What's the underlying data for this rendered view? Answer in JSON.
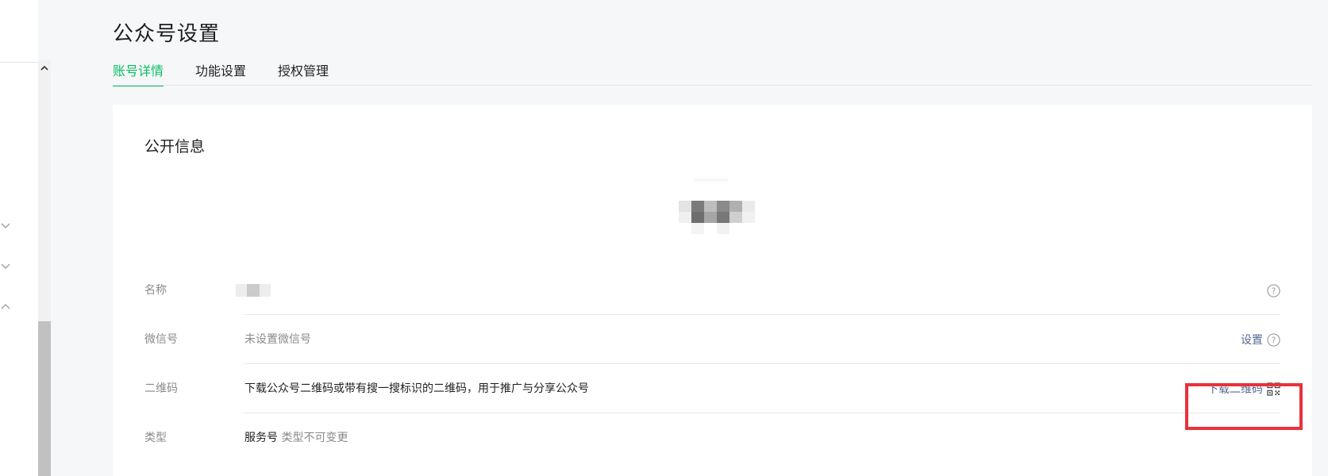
{
  "header": {
    "title": "公众号设置",
    "tabs": [
      {
        "label": "账号详情",
        "active": true
      },
      {
        "label": "功能设置",
        "active": false
      },
      {
        "label": "授权管理",
        "active": false
      }
    ]
  },
  "card": {
    "section_title": "公开信息",
    "rows": {
      "name": {
        "label": "名称"
      },
      "wechat_id": {
        "label": "微信号",
        "value": "未设置微信号",
        "action": "设置"
      },
      "qrcode": {
        "label": "二维码",
        "value": "下载公众号二维码或带有搜一搜标识的二维码，用于推广与分享公众号",
        "action": "下载二维码"
      },
      "type": {
        "label": "类型",
        "value": "服务号",
        "note": "类型不可变更"
      }
    }
  },
  "colors": {
    "accent": "#07c160",
    "link": "#576b95",
    "highlight_box": "#e8323c"
  },
  "icons": [
    "chevron-up-icon",
    "chevron-down-icon",
    "help-icon",
    "qrcode-icon"
  ]
}
